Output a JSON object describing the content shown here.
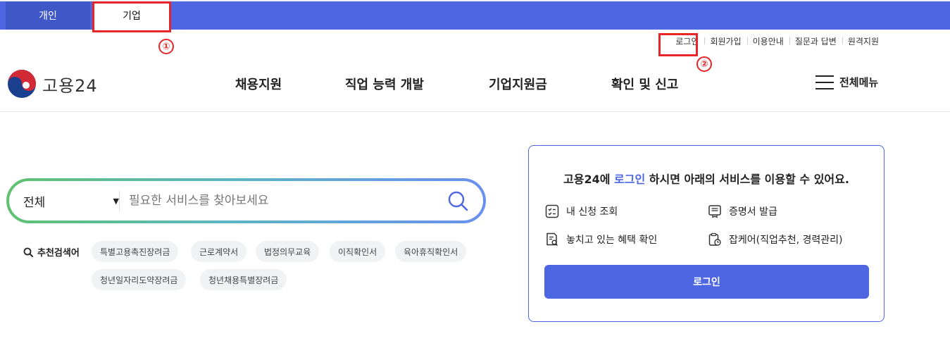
{
  "tabs": {
    "personal": "개인",
    "business": "기업"
  },
  "annotations": {
    "first": "①",
    "second": "②"
  },
  "utility_links": {
    "login": "로그인",
    "signup": "회원가입",
    "guide": "이용안내",
    "qna": "질문과 답변",
    "remote": "원격지원"
  },
  "logo": {
    "text": "고용24"
  },
  "gnb": {
    "item1": "채용지원",
    "item2": "직업 능력 개발",
    "item3": "기업지원금",
    "item4": "확인 및 신고"
  },
  "all_menu": {
    "label": "전체메뉴"
  },
  "search": {
    "category": "전체",
    "placeholder": "필요한 서비스를 찾아보세요"
  },
  "recommended": {
    "label": "추천검색어",
    "keywords": [
      "특별고용촉진장려금",
      "근로계약서",
      "법정의무교육",
      "이직확인서",
      "육아휴직확인서",
      "청년일자리도약장려금",
      "청년채용특별장려금"
    ]
  },
  "login_card": {
    "title_prefix": "고용24에 ",
    "title_highlight": "로그인",
    "title_suffix": " 하시면 아래의 서비스를 이용할 수 있어요.",
    "services": {
      "s1": "내 신청 조회",
      "s2": "증명서 발급",
      "s3": "놓치고 있는 혜택 확인",
      "s4": "잡케어(직업추천, 경력관리)"
    },
    "button": "로그인"
  },
  "colors": {
    "brand": "#4f66e3",
    "annotation": "#e8262a"
  }
}
